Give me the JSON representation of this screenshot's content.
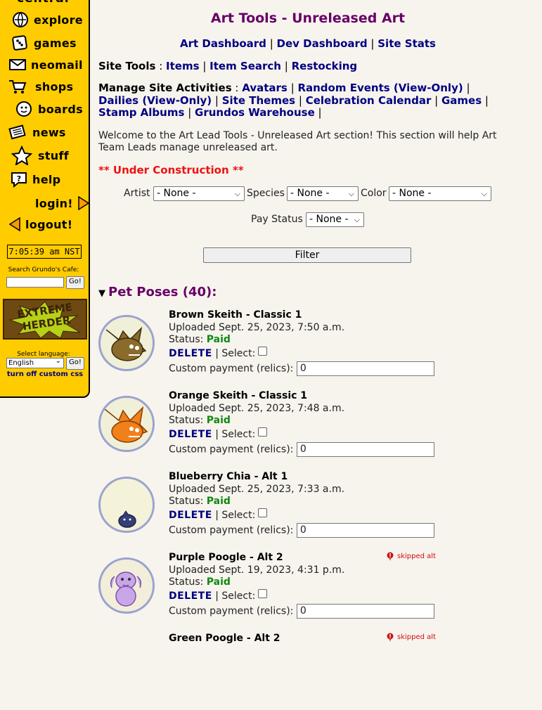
{
  "sidebar": {
    "logo": "central",
    "nav": [
      {
        "label": "explore",
        "icon": "globe-icon"
      },
      {
        "label": "games",
        "icon": "dice-icon"
      },
      {
        "label": "neomail",
        "icon": "envelope-icon"
      },
      {
        "label": "shops",
        "icon": "cart-icon"
      },
      {
        "label": "boards",
        "icon": "chat-face-icon"
      },
      {
        "label": "news",
        "icon": "newspaper-icon"
      },
      {
        "label": "stuff",
        "icon": "star-icon"
      },
      {
        "label": "help",
        "icon": "help-icon"
      },
      {
        "label": "login!",
        "icon": "arrow-right-icon"
      },
      {
        "label": "logout!",
        "icon": "arrow-left-icon"
      }
    ],
    "clock": "7:05:39 am NST",
    "search_label": "Search Grundo's Cafe:",
    "search_go": "Go!",
    "banner_text": "EXTREME HERDER",
    "language_label": "Select language:",
    "language_value": "English",
    "language_go": "Go!",
    "custom_css_link": "turn off custom css"
  },
  "page": {
    "title": "Art Tools - Unreleased Art",
    "top_links": [
      "Art Dashboard",
      "Dev Dashboard",
      "Site Stats"
    ],
    "site_tools_label": "Site Tools",
    "site_tools": [
      "Items",
      "Item Search",
      "Restocking"
    ],
    "manage_label": "Manage Site Activities",
    "manage_links": [
      "Avatars",
      "Random Events (View-Only)",
      "Dailies (View-Only)",
      "Site Themes",
      "Celebration Calendar",
      "Games",
      "Stamp Albums",
      "Grundos Warehouse"
    ],
    "welcome": "Welcome to the Art Lead Tools - Unreleased Art section! This section will help Art Team Leads manage unreleased art.",
    "under_construction": "** Under Construction **"
  },
  "filters": {
    "artist_label": "Artist",
    "artist_value": "- None -",
    "species_label": "Species",
    "species_value": "- None -",
    "color_label": "Color",
    "color_value": "- None -",
    "pay_status_label": "Pay Status",
    "pay_status_value": "- None -",
    "filter_button": "Filter"
  },
  "poses_section": {
    "title": "Pet Poses (40):",
    "uploaded_prefix": "Uploaded",
    "status_label": "Status:",
    "delete_label": "DELETE",
    "select_label": "| Select:",
    "payment_label": "Custom payment (relics):",
    "items": [
      {
        "name": "Brown Skeith - Classic 1",
        "uploaded": "Sept. 25, 2023, 7:50 a.m.",
        "status": "Paid",
        "payment": "0",
        "badge": ""
      },
      {
        "name": "Orange Skeith - Classic 1",
        "uploaded": "Sept. 25, 2023, 7:48 a.m.",
        "status": "Paid",
        "payment": "0",
        "badge": ""
      },
      {
        "name": "Blueberry Chia - Alt 1",
        "uploaded": "Sept. 25, 2023, 7:33 a.m.",
        "status": "Paid",
        "payment": "0",
        "badge": ""
      },
      {
        "name": "Purple Poogle - Alt 2",
        "uploaded": "Sept. 19, 2023, 4:31 p.m.",
        "status": "Paid",
        "payment": "0",
        "badge": "skipped alt"
      },
      {
        "name": "Green Poogle - Alt 2",
        "uploaded": "",
        "status": "",
        "payment": "",
        "badge": "skipped alt"
      }
    ]
  },
  "colors": {
    "sidebar": "#ffcc00",
    "title": "#660066",
    "link": "#000080",
    "paid": "#118811",
    "warning": "#ee1111"
  }
}
